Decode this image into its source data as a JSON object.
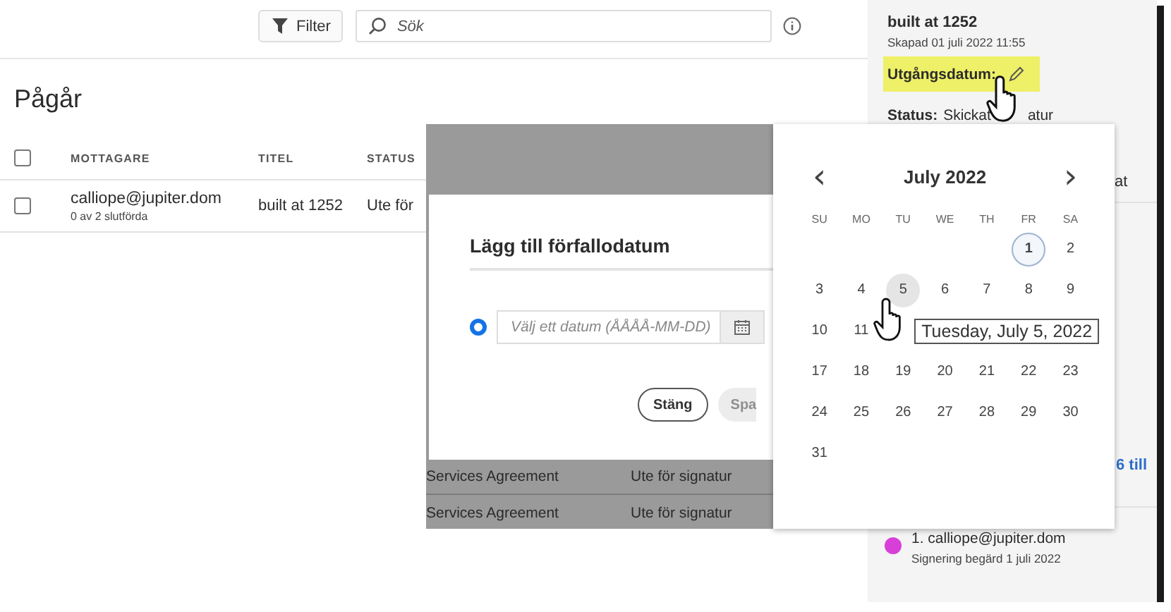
{
  "toolbar": {
    "filter_button": "Filter",
    "search": {
      "placeholder": "Sök"
    }
  },
  "section_title": "Pågår",
  "table": {
    "header_checked": false,
    "columns": [
      "MOTTAGARE",
      "TITEL",
      "STATUS"
    ],
    "rows": [
      {
        "checked": false,
        "recipient": "calliope@jupiter.dom",
        "progress": "0 av 2 slutförda",
        "title": "built at 1252",
        "status": "Ute för"
      }
    ]
  },
  "dimmed_rows": [
    {
      "title": "Services Agreement",
      "status": "Ute för signatur"
    },
    {
      "title": "Services Agreement",
      "status": "Ute för signatur"
    }
  ],
  "dialog": {
    "title": "Lägg till förfallodatum",
    "radio_selected": true,
    "date_field": {
      "placeholder": "Välj ett datum (ÅÅÅÅ-MM-DD)"
    },
    "buttons": [
      {
        "label": "Stäng",
        "disabled": false
      },
      {
        "label": "Spa",
        "disabled": true
      }
    ]
  },
  "calendar": {
    "month": "July 2022",
    "prev": "‹",
    "next": "›",
    "weekdays": [
      "SU",
      "MO",
      "TU",
      "WE",
      "TH",
      "FR",
      "SA"
    ],
    "weeks": [
      {
        "days": [
          {
            "label": "1",
            "today": true,
            "hovered": false
          },
          {
            "label": "2",
            "today": false,
            "hovered": false
          }
        ]
      },
      {
        "days": [
          {
            "label": "3",
            "today": false,
            "hovered": false
          },
          {
            "label": "4",
            "today": false,
            "hovered": false
          },
          {
            "label": "5",
            "today": false,
            "hovered": true
          },
          {
            "label": "6",
            "today": false,
            "hovered": false
          },
          {
            "label": "7",
            "today": false,
            "hovered": false
          },
          {
            "label": "8",
            "today": false,
            "hovered": false
          },
          {
            "label": "9",
            "today": false,
            "hovered": false
          }
        ]
      },
      {
        "days": [
          {
            "label": "10",
            "today": false,
            "hovered": false
          },
          {
            "label": "11",
            "today": false,
            "hovered": false
          }
        ]
      },
      {
        "days": [
          {
            "label": "17",
            "today": false,
            "hovered": false
          },
          {
            "label": "18",
            "today": false,
            "hovered": false
          },
          {
            "label": "19",
            "today": false,
            "hovered": false
          },
          {
            "label": "20",
            "today": false,
            "hovered": false
          },
          {
            "label": "21",
            "today": false,
            "hovered": false
          },
          {
            "label": "22",
            "today": false,
            "hovered": false
          },
          {
            "label": "23",
            "today": false,
            "hovered": false
          }
        ]
      },
      {
        "days": [
          {
            "label": "24",
            "today": false,
            "hovered": false
          },
          {
            "label": "25",
            "today": false,
            "hovered": false
          },
          {
            "label": "26",
            "today": false,
            "hovered": false
          },
          {
            "label": "27",
            "today": false,
            "hovered": false
          },
          {
            "label": "28",
            "today": false,
            "hovered": false
          },
          {
            "label": "29",
            "today": false,
            "hovered": false
          },
          {
            "label": "30",
            "today": false,
            "hovered": false
          }
        ]
      },
      {
        "days": [
          {
            "label": "31",
            "today": false,
            "hovered": false
          }
        ]
      }
    ],
    "tooltip": "Tuesday, July 5, 2022"
  },
  "details": {
    "title": "built at 1252",
    "created": "Skapad 01 juli 2022 11:55",
    "expiry_label": "Utgångsdatum:",
    "expiry_highlighted": true,
    "status_label": "Status:",
    "status_value": "Skickat",
    "status_value_tail": "atur",
    "fragment": "at",
    "link_fragment": "6 till",
    "recipients": [
      {
        "name": "1. calliope@jupiter.dom",
        "note": "Signering begärd 1 juli 2022",
        "color": "#d83fd8"
      }
    ]
  }
}
